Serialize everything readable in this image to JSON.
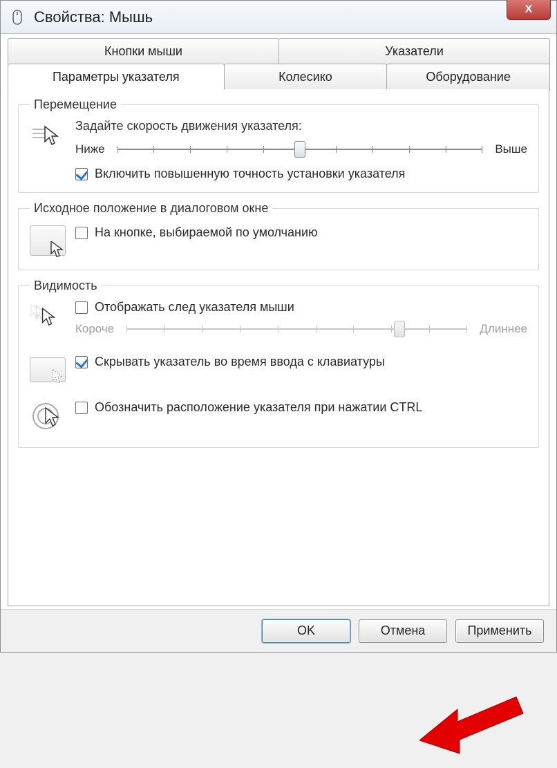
{
  "window": {
    "title": "Свойства: Мышь",
    "close_glyph": "X"
  },
  "tabs": {
    "top": [
      {
        "label": "Кнопки мыши"
      },
      {
        "label": "Указатели"
      }
    ],
    "bottom": [
      {
        "label": "Параметры указателя",
        "active": true
      },
      {
        "label": "Колесико"
      },
      {
        "label": "Оборудование"
      }
    ]
  },
  "groups": {
    "motion": {
      "legend": "Перемещение",
      "instruction": "Задайте скорость движения указателя:",
      "slower": "Ниже",
      "faster": "Выше",
      "slider_value": 5,
      "slider_ticks": 11,
      "precision_label": "Включить повышенную точность установки указателя",
      "precision_checked": true
    },
    "snap": {
      "legend": "Исходное положение в диалоговом окне",
      "label": "На кнопке, выбираемой по умолчанию",
      "checked": false
    },
    "visibility": {
      "legend": "Видимость",
      "trails_label": "Отображать след указателя мыши",
      "trails_checked": false,
      "trails_shorter": "Короче",
      "trails_longer": "Длиннее",
      "trails_slider_value": 8,
      "trails_slider_ticks": 10,
      "hide_label": "Скрывать указатель во время ввода с клавиатуры",
      "hide_checked": true,
      "ctrl_label": "Обозначить расположение указателя при нажатии CTRL",
      "ctrl_checked": false
    }
  },
  "footer": {
    "ok": "OK",
    "cancel": "Отмена",
    "apply": "Применить"
  }
}
